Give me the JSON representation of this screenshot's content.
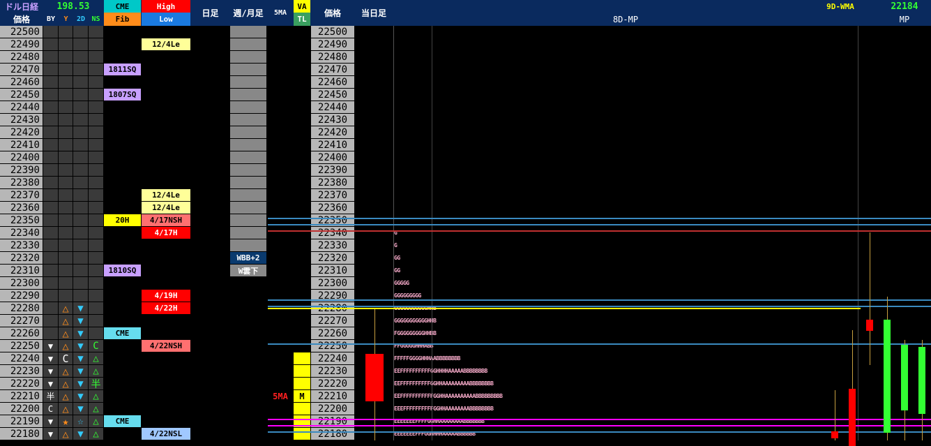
{
  "header": {
    "index_name": "ドル日経",
    "usdjpy": "198.53",
    "price_label": "価格",
    "by_label": "BY",
    "y_label": "Y",
    "twod_label": "2D",
    "ns_label": "NS",
    "cme_label": "CME",
    "fib_label": "Fib",
    "high_label": "High",
    "low_label": "Low",
    "daily_label": "日足",
    "weekly_label": "週/月足",
    "fivema_label": "5MA",
    "va_label": "VA",
    "tl_label": "TL",
    "price_label2": "価格",
    "today_label": "当日足",
    "mp_title": "8D-MP",
    "wma_label": "9D-WMA",
    "wma_value": "22184",
    "mp_label": "MP"
  },
  "colors": {
    "header_bg": "#0a2a5e",
    "price_bg": "#b7b7b7",
    "yellow": "#ffff00",
    "red": "#ff0000",
    "green": "#33ff33",
    "cyan": "#00ccff",
    "magenta": "#ff00ff",
    "steelblue": "#3a8ac0"
  },
  "rows": [
    {
      "price": "22500",
      "by": "",
      "y": "",
      "twod": "",
      "ns": "",
      "cme": "",
      "hl": "",
      "wk": "",
      "ma": "",
      "va": "",
      "tpo": ""
    },
    {
      "price": "22490",
      "by": "",
      "y": "",
      "twod": "",
      "ns": "",
      "cme": "",
      "hl": "12/4Le",
      "wk": "",
      "ma": "",
      "va": "",
      "tpo": ""
    },
    {
      "price": "22480",
      "by": "",
      "y": "",
      "twod": "",
      "ns": "",
      "cme": "",
      "hl": "",
      "wk": "",
      "ma": "",
      "va": "",
      "tpo": ""
    },
    {
      "price": "22470",
      "by": "",
      "y": "",
      "twod": "",
      "ns": "",
      "cme": "1811SQ",
      "hl": "",
      "wk": "",
      "ma": "",
      "va": "",
      "tpo": ""
    },
    {
      "price": "22460",
      "by": "",
      "y": "",
      "twod": "",
      "ns": "",
      "cme": "",
      "hl": "",
      "wk": "",
      "ma": "",
      "va": "",
      "tpo": ""
    },
    {
      "price": "22450",
      "by": "",
      "y": "",
      "twod": "",
      "ns": "",
      "cme": "1807SQ",
      "hl": "",
      "wk": "",
      "ma": "",
      "va": "",
      "tpo": ""
    },
    {
      "price": "22440",
      "by": "",
      "y": "",
      "twod": "",
      "ns": "",
      "cme": "",
      "hl": "",
      "wk": "",
      "ma": "",
      "va": "",
      "tpo": ""
    },
    {
      "price": "22430",
      "by": "",
      "y": "",
      "twod": "",
      "ns": "",
      "cme": "",
      "hl": "",
      "wk": "",
      "ma": "",
      "va": "",
      "tpo": ""
    },
    {
      "price": "22420",
      "by": "",
      "y": "",
      "twod": "",
      "ns": "",
      "cme": "",
      "hl": "",
      "wk": "",
      "ma": "",
      "va": "",
      "tpo": ""
    },
    {
      "price": "22410",
      "by": "",
      "y": "",
      "twod": "",
      "ns": "",
      "cme": "",
      "hl": "",
      "wk": "",
      "ma": "",
      "va": "",
      "tpo": ""
    },
    {
      "price": "22400",
      "by": "",
      "y": "",
      "twod": "",
      "ns": "",
      "cme": "",
      "hl": "",
      "wk": "",
      "ma": "",
      "va": "",
      "tpo": ""
    },
    {
      "price": "22390",
      "by": "",
      "y": "",
      "twod": "",
      "ns": "",
      "cme": "",
      "hl": "",
      "wk": "",
      "ma": "",
      "va": "",
      "tpo": ""
    },
    {
      "price": "22380",
      "by": "",
      "y": "",
      "twod": "",
      "ns": "",
      "cme": "",
      "hl": "",
      "wk": "",
      "ma": "",
      "va": "",
      "tpo": ""
    },
    {
      "price": "22370",
      "by": "",
      "y": "",
      "twod": "",
      "ns": "",
      "cme": "",
      "hl": "12/4Le",
      "wk": "",
      "ma": "",
      "va": "",
      "tpo": ""
    },
    {
      "price": "22360",
      "by": "",
      "y": "",
      "twod": "",
      "ns": "",
      "cme": "",
      "hl": "12/4Le",
      "wk": "",
      "ma": "",
      "va": "",
      "tpo": ""
    },
    {
      "price": "22350",
      "by": "",
      "y": "",
      "twod": "",
      "ns": "",
      "cme": "20H",
      "hl": "4/17NSH",
      "wk": "",
      "ma": "",
      "va": "",
      "tpo": ""
    },
    {
      "price": "22340",
      "by": "",
      "y": "",
      "twod": "",
      "ns": "",
      "cme": "",
      "hl": "4/17H",
      "wk": "",
      "ma": "",
      "va": "",
      "tpo": "G"
    },
    {
      "price": "22330",
      "by": "",
      "y": "",
      "twod": "",
      "ns": "",
      "cme": "",
      "hl": "",
      "wk": "",
      "ma": "",
      "va": "",
      "tpo": "G"
    },
    {
      "price": "22320",
      "by": "",
      "y": "",
      "twod": "",
      "ns": "",
      "cme": "",
      "hl": "",
      "wk": "WBB+2",
      "ma": "",
      "va": "",
      "tpo": "GG"
    },
    {
      "price": "22310",
      "by": "",
      "y": "",
      "twod": "",
      "ns": "",
      "cme": "1810SQ",
      "hl": "",
      "wk": "W雲下",
      "ma": "",
      "va": "",
      "tpo": "GG"
    },
    {
      "price": "22300",
      "by": "",
      "y": "",
      "twod": "",
      "ns": "",
      "cme": "",
      "hl": "",
      "wk": "",
      "ma": "",
      "va": "",
      "tpo": "GGGGG"
    },
    {
      "price": "22290",
      "by": "",
      "y": "",
      "twod": "",
      "ns": "",
      "cme": "",
      "hl": "4/19H",
      "wk": "",
      "ma": "",
      "va": "",
      "tpo": "GGGGGGGGG"
    },
    {
      "price": "22280",
      "by": "",
      "y": "△",
      "twod": "▼",
      "ns": "",
      "cme": "",
      "hl": "4/22H",
      "wk": "",
      "ma": "",
      "va": "",
      "tpo": "GGGGGGGGGGGHHB"
    },
    {
      "price": "22270",
      "by": "",
      "y": "△",
      "twod": "▼",
      "ns": "",
      "cme": "",
      "hl": "",
      "wk": "",
      "ma": "",
      "va": "",
      "tpo": "GGGGGGGGGGGHHB"
    },
    {
      "price": "22260",
      "by": "",
      "y": "△",
      "twod": "▼",
      "ns": "",
      "cme": "CME",
      "hl": "",
      "wk": "",
      "ma": "",
      "va": "",
      "tpo": "FGGGGGGGGGHHBB"
    },
    {
      "price": "22250",
      "by": "▼",
      "y": "△",
      "twod": "▼",
      "ns": "C",
      "cme": "",
      "hl": "4/22NSH",
      "wk": "",
      "ma": "",
      "va": "",
      "tpo": "FFGGGGGHHHABB"
    },
    {
      "price": "22240",
      "by": "▼",
      "y": "C",
      "twod": "▼",
      "ns": "△",
      "cme": "",
      "hl": "",
      "wk": "",
      "ma": "",
      "va": "",
      "tpo": "FFFFFGGGGHHHAABBBBBBBB"
    },
    {
      "price": "22230",
      "by": "▼",
      "y": "△",
      "twod": "▼",
      "ns": "△",
      "cme": "",
      "hl": "",
      "wk": "",
      "ma": "",
      "va": "",
      "tpo": "EEFFFFFFFFFFGGHHHHAAAAABBBBBBBB"
    },
    {
      "price": "22220",
      "by": "▼",
      "y": "△",
      "twod": "▼",
      "ns": "半",
      "cme": "",
      "hl": "",
      "wk": "",
      "ma": "",
      "va": "",
      "tpo": "EEFFFFFFFFFFGGHHAAAAAAAAABBBBBBBB"
    },
    {
      "price": "22210",
      "by": "半",
      "y": "△",
      "twod": "▼",
      "ns": "△",
      "cme": "",
      "hl": "",
      "wk": "",
      "ma": "5MA",
      "va": "M",
      "tpo": "EEFFFFFFFFFFFGGHHAAAAAAAAAABBBBBBBBB"
    },
    {
      "price": "22200",
      "by": "C",
      "y": "△",
      "twod": "▼",
      "ns": "△",
      "cme": "",
      "hl": "",
      "wk": "",
      "ma": "",
      "va": "",
      "tpo": "EEEFFFFFFFFFFGGHHAAAAAAAABBBBBBBB"
    },
    {
      "price": "22190",
      "by": "▼",
      "y": "★",
      "twod": "☆",
      "ns": "△",
      "cme": "CME",
      "hl": "",
      "wk": "",
      "ma": "",
      "va": "",
      "tpo": "EEEEEEEFFFFGGHHAAAAAAAABBBBBBB"
    },
    {
      "price": "22180",
      "by": "▼",
      "y": "△",
      "twod": "▼",
      "ns": "△",
      "cme": "",
      "hl": "4/22NSL",
      "wk": "",
      "ma": "",
      "va": "",
      "tpo": "EEEEEEEFFFGGHHHHAAAAABBBBBB"
    }
  ]
}
